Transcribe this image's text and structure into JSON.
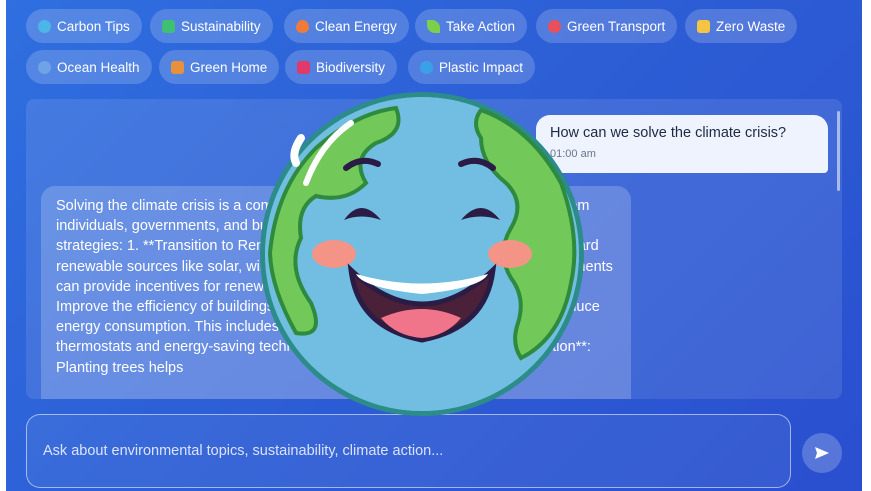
{
  "chips": [
    {
      "label": "Carbon Tips",
      "icon": "globe-icon",
      "color": "#4db6e8"
    },
    {
      "label": "Sustainability",
      "icon": "recycle-icon",
      "color": "#3fbf72"
    },
    {
      "label": "Clean Energy",
      "icon": "flame-icon",
      "color": "#f07a3a"
    },
    {
      "label": "Take Action",
      "icon": "leaf-icon",
      "color": "#7ccf4a"
    },
    {
      "label": "Green Transport",
      "icon": "bicycle-icon",
      "color": "#e8505b"
    },
    {
      "label": "Zero Waste",
      "icon": "folder-icon",
      "color": "#f5c542"
    },
    {
      "label": "Ocean Health",
      "icon": "planet-icon",
      "color": "#6fa3e8"
    },
    {
      "label": "Green Home",
      "icon": "house-icon",
      "color": "#e8903a"
    },
    {
      "label": "Biodiversity",
      "icon": "butterfly-icon",
      "color": "#e03a6a"
    },
    {
      "label": "Plastic Impact",
      "icon": "wave-icon",
      "color": "#3aa0e8"
    }
  ],
  "conversation": {
    "user_message": {
      "text": "How can we solve the climate crisis?",
      "time": "01:00 am"
    },
    "bot_message": {
      "text": "Solving the climate crisis is a complex challenge that requires collective action from individuals, governments, and businesses around the world. Here are some key strategies: 1. **Transition to Renewable Energy**: Shift away from fossil fuels toward renewable sources like solar, wind, hydroelectric, and geothermal power. Governments can provide incentives for renewable energy adoption. 2. **Energy Efficiency**: Improve the efficiency of buildings, transportation, and industrial processes to reduce energy consumption. This includes better heating, efficient insulation, smart thermostats and energy-saving technologies. 3. **Afforestation and Reforestation**: Planting trees helps"
    }
  },
  "input": {
    "placeholder": "Ask about environmental topics, sustainability, climate action..."
  },
  "send_button": {
    "icon": "send-icon"
  },
  "mascot": {
    "icon": "smiling-earth-icon"
  }
}
